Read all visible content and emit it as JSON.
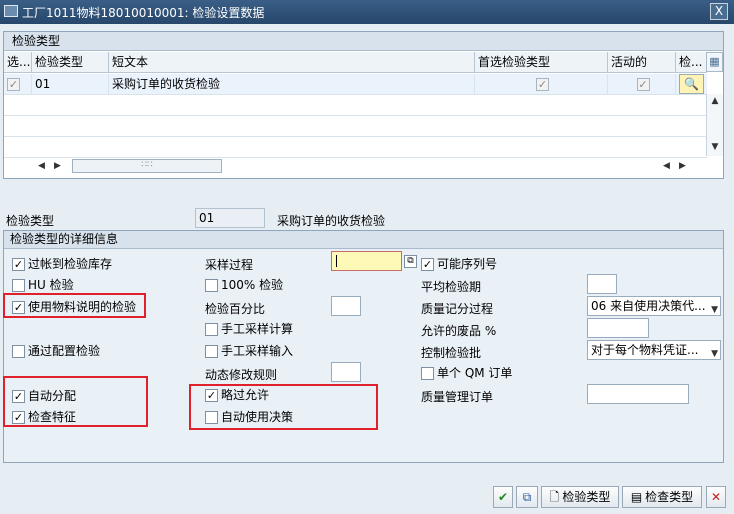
{
  "window": {
    "title": "工厂1011物料18010010001: 检验设置数据",
    "close_label": "X"
  },
  "table": {
    "pane_title": "检验类型",
    "columns": [
      "选...",
      "检验类型",
      "短文本",
      "首选检验类型",
      "活动的",
      "检..."
    ],
    "rows": [
      {
        "selected": true,
        "type": "01",
        "text": "采购订单的收货检验",
        "preferred": true,
        "active": true
      }
    ]
  },
  "header_field": {
    "label": "检验类型",
    "value": "01",
    "description": "采购订单的收货检验"
  },
  "details": {
    "section_title": "检验类型的详细信息",
    "col1": [
      {
        "label": "过帐到检验库存",
        "checked": true
      },
      {
        "label": "HU 检验",
        "checked": false
      },
      {
        "label": "使用物料说明的检验",
        "checked": true
      },
      {
        "label": "通过配置检验",
        "checked": false
      },
      {
        "label": "自动分配",
        "checked": true
      },
      {
        "label": "检查特征",
        "checked": true
      }
    ],
    "col2": {
      "sampling_procedure_label": "采样过程",
      "hundred_pct_label": "100% 检验",
      "hundred_pct_checked": false,
      "inspection_pct_label": "检验百分比",
      "manual_sample_calc_label": "手工采样计算",
      "manual_sample_calc_checked": false,
      "manual_sample_entry_label": "手工采样输入",
      "manual_sample_entry_checked": false,
      "dynamic_rule_label": "动态修改规则",
      "skips_allowed_label": "略过允许",
      "skips_allowed_checked": true,
      "auto_ud_label": "自动使用决策",
      "auto_ud_checked": false
    },
    "col3": {
      "serial_label": "可能序列号",
      "serial_checked": true,
      "avg_duration_label": "平均检验期",
      "qscore_label": "质量记分过程",
      "qscore_value": "06 来自使用决策代...",
      "allowed_scrap_label": "允许的废品 %",
      "control_lot_label": "控制检验批",
      "control_lot_value": "对于每个物料凭证...",
      "single_qm_label": "单个 QM 订单",
      "single_qm_checked": false,
      "qm_order_label": "质量管理订单"
    }
  },
  "buttons": {
    "insp_type_label": "检验类型",
    "check_type_label": "检查类型"
  },
  "colors": {
    "highlight": "#e0202a",
    "focus_field": "#fff9b8",
    "titlebar": "#27476b"
  }
}
